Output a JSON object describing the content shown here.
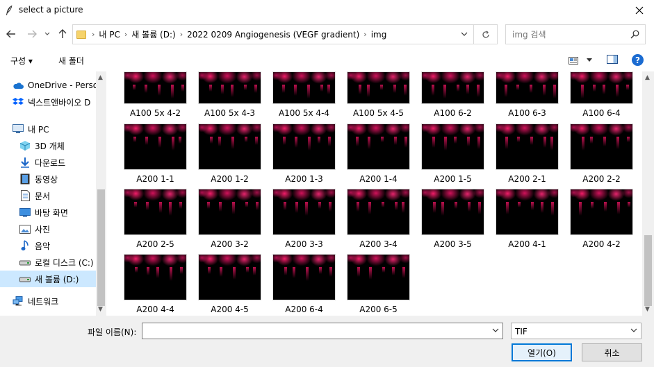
{
  "window": {
    "title": "select a picture"
  },
  "address": {
    "segments": [
      "내 PC",
      "새 볼륨 (D:)",
      "2022 0209 Angiogenesis (VEGF gradient)",
      "img"
    ]
  },
  "search": {
    "placeholder": "img 검색"
  },
  "toolbar": {
    "organize_label": "구성 ▾",
    "new_folder_label": "새 폴더"
  },
  "nav": {
    "items": [
      {
        "label": "OneDrive - Person",
        "icon": "cloud-icon"
      },
      {
        "label": "넥스트앤바이오 D",
        "icon": "dropbox-icon"
      },
      {
        "label": "내 PC",
        "icon": "computer-icon"
      },
      {
        "label": "3D 개체",
        "icon": "cube-icon"
      },
      {
        "label": "다운로드",
        "icon": "download-icon"
      },
      {
        "label": "동영상",
        "icon": "video-icon"
      },
      {
        "label": "문서",
        "icon": "document-icon"
      },
      {
        "label": "바탕 화면",
        "icon": "desktop-icon"
      },
      {
        "label": "사진",
        "icon": "pictures-icon"
      },
      {
        "label": "음악",
        "icon": "music-icon"
      },
      {
        "label": "로컬 디스크 (C:)",
        "icon": "drive-icon"
      },
      {
        "label": "새 볼륨 (D:)",
        "icon": "drive-icon",
        "selected": true
      },
      {
        "label": "네트워크",
        "icon": "network-icon"
      }
    ]
  },
  "files": [
    "A100 5x 4-2",
    "A100 5x 4-3",
    "A100 5x 4-4",
    "A100 5x 4-5",
    "A100 6-2",
    "A100 6-3",
    "A100 6-4",
    "A200 1-1",
    "A200 1-2",
    "A200 1-3",
    "A200 1-4",
    "A200 1-5",
    "A200 2-1",
    "A200 2-2",
    "A200 2-5",
    "A200 3-2",
    "A200 3-3",
    "A200 3-4",
    "A200 3-5",
    "A200 4-1",
    "A200 4-2",
    "A200 4-4",
    "A200 4-5",
    "A200 6-4",
    "A200 6-5"
  ],
  "footer": {
    "filename_label": "파일 이름(N):",
    "filename_value": "",
    "filetype": "TIF",
    "open_label": "열기(O)",
    "cancel_label": "취소"
  },
  "colors": {
    "accent": "#0078d7",
    "selection": "#cce8ff",
    "thumb_glow": "#ff1e6e"
  }
}
